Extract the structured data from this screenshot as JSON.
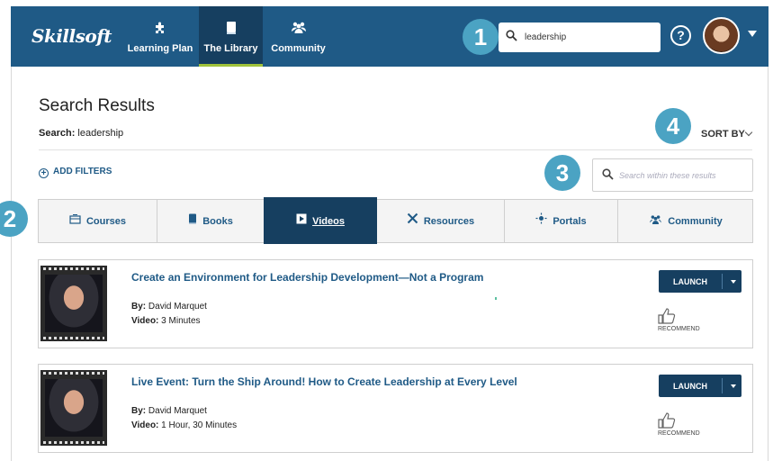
{
  "header": {
    "logo_text": "Skillsoft",
    "nav": [
      {
        "label": "Learning Plan",
        "icon": "puzzle-icon"
      },
      {
        "label": "The Library",
        "icon": "book-icon"
      },
      {
        "label": "Community",
        "icon": "people-icon"
      }
    ],
    "search_value": "leadership",
    "help_label": "?",
    "accent_color": "#1f5a86",
    "active_underline_color": "#9fc23a"
  },
  "callouts": [
    "1",
    "2",
    "3",
    "4"
  ],
  "results": {
    "title": "Search Results",
    "search_label": "Search:",
    "search_term": "leadership",
    "sort_label": "SORT BY",
    "add_filters_label": "ADD FILTERS",
    "within_placeholder": "Search within these results"
  },
  "tabs": [
    {
      "label": "Courses",
      "icon": "courses-icon"
    },
    {
      "label": "Books",
      "icon": "book-icon"
    },
    {
      "label": "Videos",
      "icon": "video-icon",
      "active": true
    },
    {
      "label": "Resources",
      "icon": "tools-icon"
    },
    {
      "label": "Portals",
      "icon": "portal-icon"
    },
    {
      "label": "Community",
      "icon": "people-icon"
    }
  ],
  "items": [
    {
      "title": "Create an Environment for Leadership Development—Not a Program",
      "by_label": "By:",
      "author": "David Marquet",
      "video_label": "Video:",
      "duration": "3 Minutes",
      "launch_label": "LAUNCH",
      "recommend_label": "RECOMMEND"
    },
    {
      "title": "Live Event: Turn the Ship Around! How to Create Leadership at Every Level",
      "by_label": "By:",
      "author": "David Marquet",
      "video_label": "Video:",
      "duration": "1 Hour, 30 Minutes",
      "launch_label": "LAUNCH",
      "recommend_label": "RECOMMEND"
    }
  ]
}
